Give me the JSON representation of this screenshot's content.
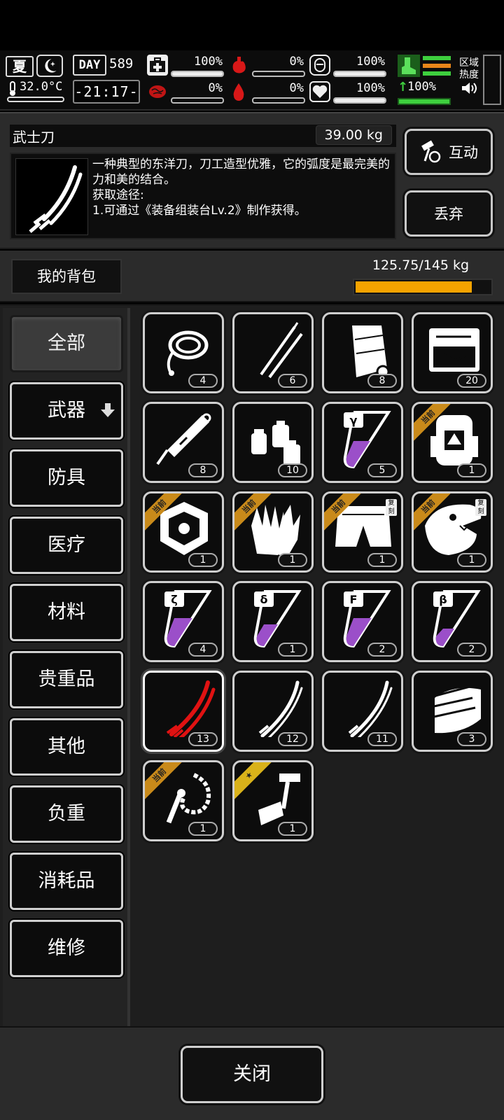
{
  "status": {
    "season": "夏",
    "temperature": "32.0°C",
    "day_label": "DAY",
    "day_number": "589",
    "clock": "-21:17-",
    "area_label": "区域热度",
    "stats": [
      {
        "id": "health",
        "icon": "medkit-icon",
        "value": "100%",
        "level": 1.0
      },
      {
        "id": "hunger",
        "icon": "stomach-icon",
        "value": "0%",
        "level": 0.0
      },
      {
        "id": "armor",
        "icon": "shield-icon",
        "value": "100%",
        "level": 1.0
      },
      {
        "id": "mental",
        "icon": "brain-icon",
        "value": "0%",
        "level": 0.0
      },
      {
        "id": "thirst",
        "icon": "water-drop-icon",
        "value": "0%",
        "level": 0.0
      },
      {
        "id": "mood",
        "icon": "heart-icon",
        "value": "100%",
        "level": 1.0
      }
    ],
    "stamina_value": "100%"
  },
  "item": {
    "name": "武士刀",
    "weight": "39.00 kg",
    "description": "一种典型的东洋刀，刀工造型优雅，它的弧度是最完美的力和美的结合。\n获取途径:\n1.可通过《装备组装台Lv.2》制作获得。",
    "interact_label": "互动",
    "discard_label": "丢弃"
  },
  "bag": {
    "title": "我的背包",
    "capacity": "125.75/145 kg",
    "fill_level": 0.867
  },
  "categories": [
    {
      "label": "全部",
      "active": true
    },
    {
      "label": "武器"
    },
    {
      "label": "防具"
    },
    {
      "label": "医疗"
    },
    {
      "label": "材料"
    },
    {
      "label": "贵重品"
    },
    {
      "label": "其他"
    },
    {
      "label": "负重"
    },
    {
      "label": "消耗品"
    },
    {
      "label": "维修"
    }
  ],
  "badge_current": "当前",
  "badge_copy": "复刻",
  "items": [
    {
      "icon": "rope-icon",
      "count": "4"
    },
    {
      "icon": "lockpick-icon",
      "count": "6"
    },
    {
      "icon": "scroll-icon",
      "count": "8"
    },
    {
      "icon": "toolbox-icon",
      "count": "20"
    },
    {
      "icon": "syringe-icon",
      "count": "8"
    },
    {
      "icon": "bottles-icon",
      "count": "10"
    },
    {
      "icon": "test-tube-icon",
      "count": "5",
      "label": "γ",
      "fill": 0.55
    },
    {
      "icon": "backpack-icon",
      "count": "1",
      "current": true
    },
    {
      "icon": "armor-plate-icon",
      "count": "1",
      "current": true
    },
    {
      "icon": "gloves-icon",
      "count": "1",
      "current": true
    },
    {
      "icon": "shorts-icon",
      "count": "1",
      "current": true,
      "copy": true
    },
    {
      "icon": "dino-mask-icon",
      "count": "1",
      "current": true,
      "copy": true
    },
    {
      "icon": "test-tube-icon",
      "count": "4",
      "label": "ζ",
      "fill": 0.6
    },
    {
      "icon": "test-tube-icon",
      "count": "1",
      "label": "δ",
      "fill": 0.45
    },
    {
      "icon": "test-tube-icon",
      "count": "2",
      "label": "F",
      "fill": 0.6
    },
    {
      "icon": "test-tube-icon",
      "count": "2",
      "label": "β",
      "fill": 0.35
    },
    {
      "icon": "red-katana-icon",
      "count": "13",
      "selected": true
    },
    {
      "icon": "katana-icon",
      "count": "12"
    },
    {
      "icon": "katana-icon",
      "count": "11"
    },
    {
      "icon": "claw-shield-icon",
      "count": "3"
    },
    {
      "icon": "bone-whip-icon",
      "count": "1",
      "current": true
    },
    {
      "icon": "hammer-knife-icon",
      "count": "1",
      "star": true
    }
  ],
  "close_label": "关闭",
  "colors": {
    "capacity_fill": "#f5a300",
    "tag_current": "#c98a1a",
    "tube_liquid": "#9b4fc9",
    "red_weapon": "#e01212",
    "stamina_green": "#3ecf3e",
    "danger_red": "#d81818"
  }
}
